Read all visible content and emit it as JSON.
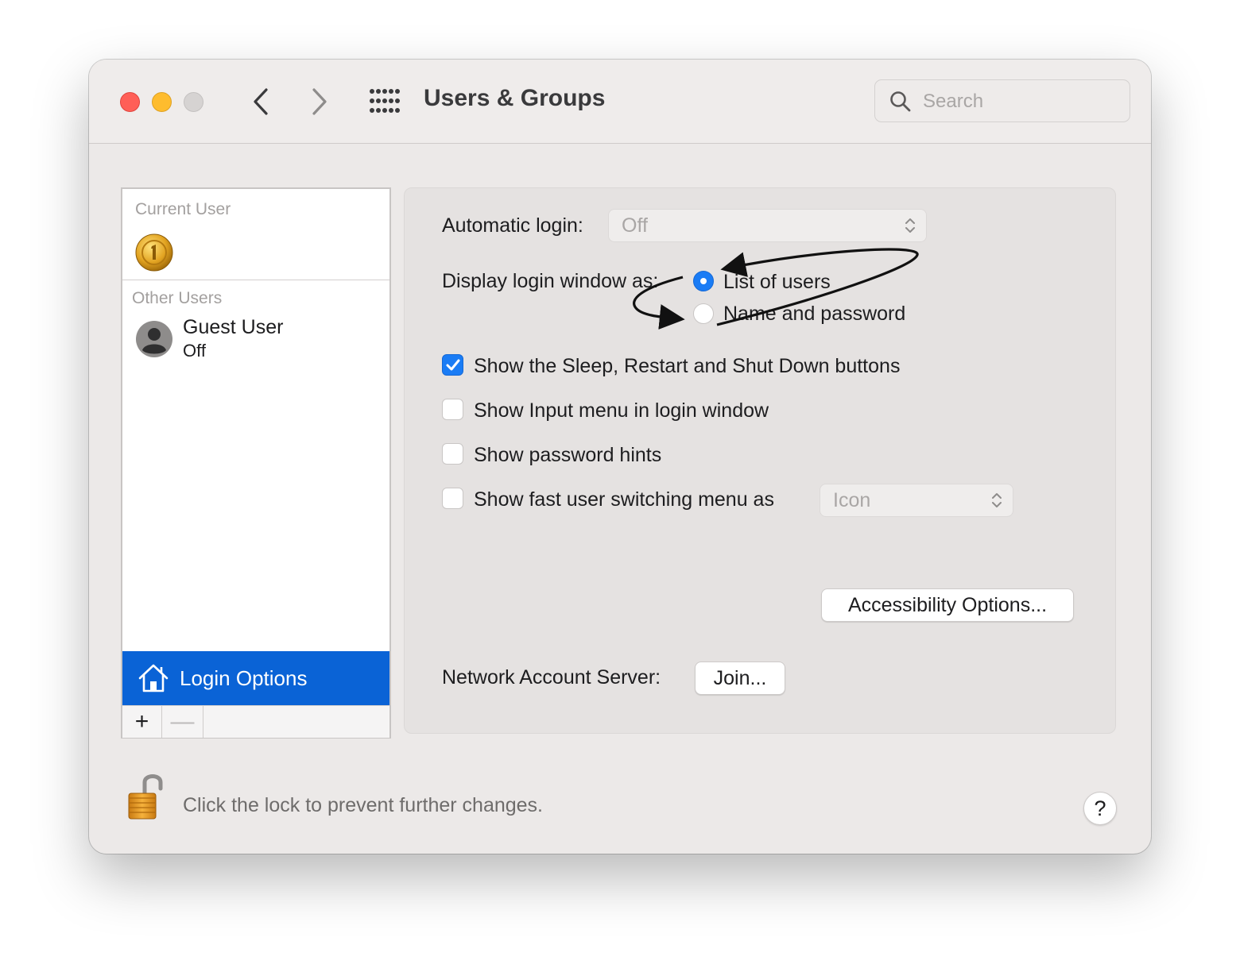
{
  "window": {
    "title": "Users & Groups",
    "search_placeholder": "Search"
  },
  "sidebar": {
    "current_user_label": "Current User",
    "other_users_label": "Other Users",
    "guest": {
      "name": "Guest User",
      "status": "Off"
    },
    "login_options_label": "Login Options",
    "add_symbol": "+",
    "remove_symbol": "—"
  },
  "login_panel": {
    "automatic_login_label": "Automatic login:",
    "automatic_login_value": "Off",
    "display_login_label": "Display login window as:",
    "radio_list": "List of users",
    "radio_name": "Name and password",
    "selected_radio": "List of users",
    "checkboxes": [
      {
        "label": "Show the Sleep, Restart and Shut Down buttons",
        "checked": true
      },
      {
        "label": "Show Input menu in login window",
        "checked": false
      },
      {
        "label": "Show password hints",
        "checked": false
      },
      {
        "label": "Show fast user switching menu as",
        "checked": false
      }
    ],
    "fast_switch_value": "Icon",
    "accessibility_button": "Accessibility Options...",
    "network_label": "Network Account Server:",
    "join_button": "Join..."
  },
  "footer": {
    "lock_text": "Click the lock to prevent further changes.",
    "help_symbol": "?"
  },
  "colors": {
    "accent": "#1a7cf5",
    "selection": "#0a63d6",
    "close": "#ff5f57",
    "minimize": "#febc2e"
  },
  "icons": [
    "close-button",
    "minimize-button",
    "zoom-button",
    "back-chevron-icon",
    "forward-chevron-icon",
    "grid-icon",
    "search-icon",
    "gold-medal-icon",
    "guest-avatar-icon",
    "house-icon",
    "lock-icon",
    "up-down-arrows-icon",
    "checkmark-icon",
    "swap-arrows-annotation"
  ]
}
